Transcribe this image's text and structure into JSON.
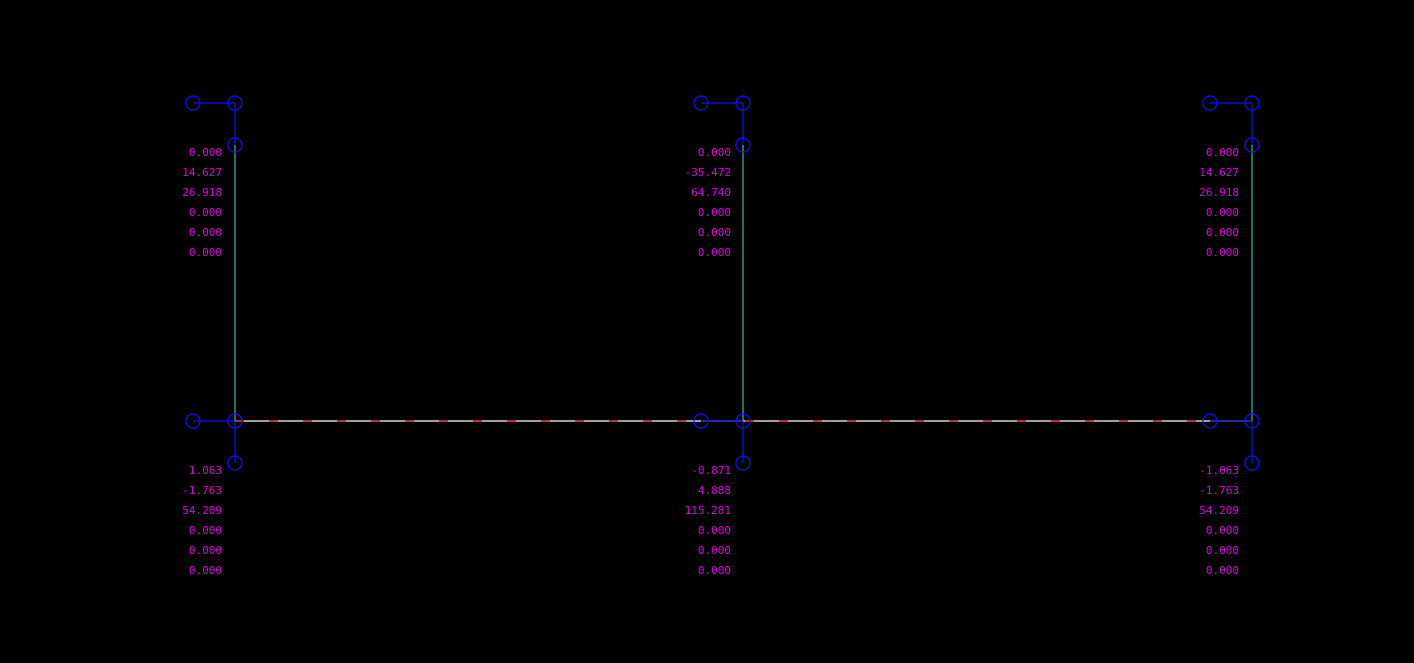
{
  "colors": {
    "background": "#000000",
    "column": "#40e0d0",
    "beam": "#ffffff",
    "beam_dash": "#ff2a2a",
    "node_symbol": "#1010ff",
    "text": "#e000e0"
  },
  "icons": {
    "node": "node-circle-icon",
    "local_axis": "local-axis-icon"
  },
  "columns": [
    {
      "id": "left",
      "top_values": [
        "0.000",
        "14.627",
        "26.918",
        "0.000",
        "0.000",
        "0.000"
      ],
      "bottom_values": [
        "1.063",
        "-1.763",
        "54.209",
        "0.000",
        "0.000",
        "0.000"
      ]
    },
    {
      "id": "middle",
      "top_values": [
        "0.000",
        "-35.472",
        "64.740",
        "0.000",
        "0.000",
        "0.000"
      ],
      "bottom_values": [
        "-0.871",
        "4.888",
        "115.281",
        "0.000",
        "0.000",
        "0.000"
      ]
    },
    {
      "id": "right",
      "top_values": [
        "0.000",
        "14.627",
        "26.918",
        "0.000",
        "0.000",
        "0.000"
      ],
      "bottom_values": [
        "-1.063",
        "-1.763",
        "54.209",
        "0.000",
        "0.000",
        "0.000"
      ]
    }
  ]
}
